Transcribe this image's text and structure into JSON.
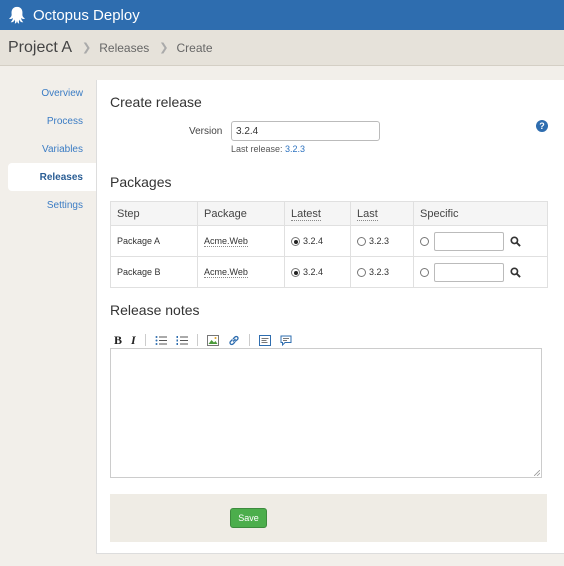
{
  "app": {
    "title": "Octopus Deploy"
  },
  "breadcrumb": {
    "project": "Project A",
    "items": [
      "Releases",
      "Create"
    ]
  },
  "sidebar": {
    "items": [
      {
        "label": "Overview",
        "active": false
      },
      {
        "label": "Process",
        "active": false
      },
      {
        "label": "Variables",
        "active": false
      },
      {
        "label": "Releases",
        "active": true
      },
      {
        "label": "Settings",
        "active": false
      }
    ]
  },
  "create_release": {
    "title": "Create release",
    "version_label": "Version",
    "version_value": "3.2.4",
    "last_release_prefix": "Last release:",
    "last_release_value": "3.2.3",
    "help_glyph": "?"
  },
  "packages": {
    "title": "Packages",
    "columns": [
      "Step",
      "Package",
      "Latest",
      "Last",
      "Specific"
    ],
    "rows": [
      {
        "step": "Package A",
        "package": "Acme.Web",
        "latest": "3.2.4",
        "last": "3.2.3",
        "selected": "latest"
      },
      {
        "step": "Package B",
        "package": "Acme.Web",
        "latest": "3.2.4",
        "last": "3.2.3",
        "selected": "latest"
      }
    ]
  },
  "release_notes": {
    "title": "Release notes",
    "toolbar": {
      "bold": "B",
      "italic": "I"
    }
  },
  "actions": {
    "save_label": "Save"
  },
  "colors": {
    "topbar": "#2e6daf",
    "link": "#3b7cc4",
    "save": "#4cae4c"
  }
}
